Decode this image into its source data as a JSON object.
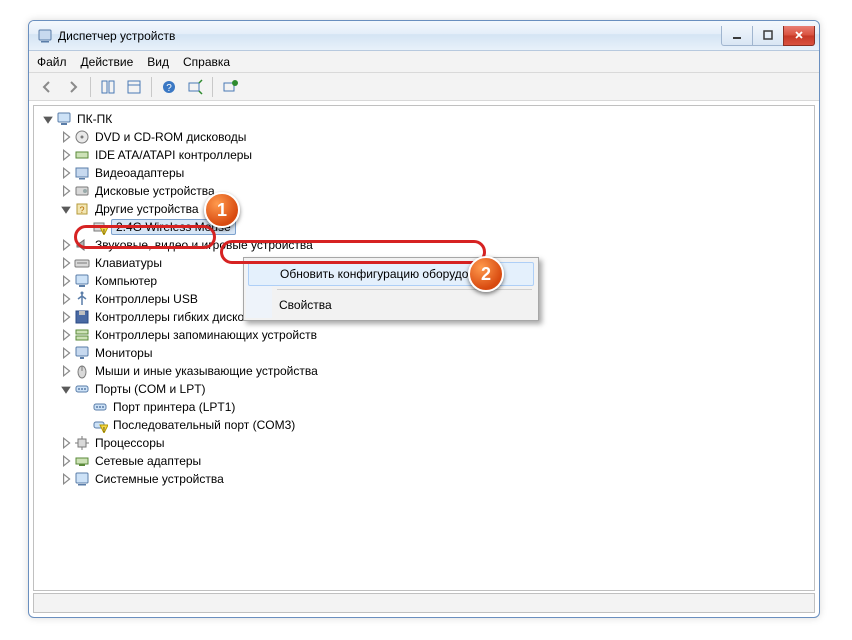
{
  "window": {
    "title": "Диспетчер устройств"
  },
  "menu": {
    "file": "Файл",
    "action": "Действие",
    "view": "Вид",
    "help": "Справка"
  },
  "tree": {
    "root": "ПК-ПК",
    "dvd": "DVD и CD-ROM дисководы",
    "ide": "IDE ATA/ATAPI контроллеры",
    "video": "Видеоадаптеры",
    "disk": "Дисковые устройства",
    "other": "Другие устройства",
    "wireless_mouse": "2.4G Wireless Mouse",
    "audio": "Звуковые, видео и игровые устройства",
    "keyboards": "Клавиатуры",
    "computer": "Компьютер",
    "usb": "Контроллеры USB",
    "floppy": "Контроллеры гибких дисков",
    "storage": "Контроллеры запоминающих устройств",
    "monitors": "Мониторы",
    "mice": "Мыши и иные указывающие устройства",
    "ports": "Порты (COM и LPT)",
    "lpt1": "Порт принтера (LPT1)",
    "com3": "Последовательный порт (COM3)",
    "cpu": "Процессоры",
    "network": "Сетевые адаптеры",
    "system": "Системные устройства"
  },
  "context_menu": {
    "scan": "Обновить конфигурацию оборудования",
    "properties": "Свойства"
  },
  "callouts": {
    "one": "1",
    "two": "2"
  }
}
